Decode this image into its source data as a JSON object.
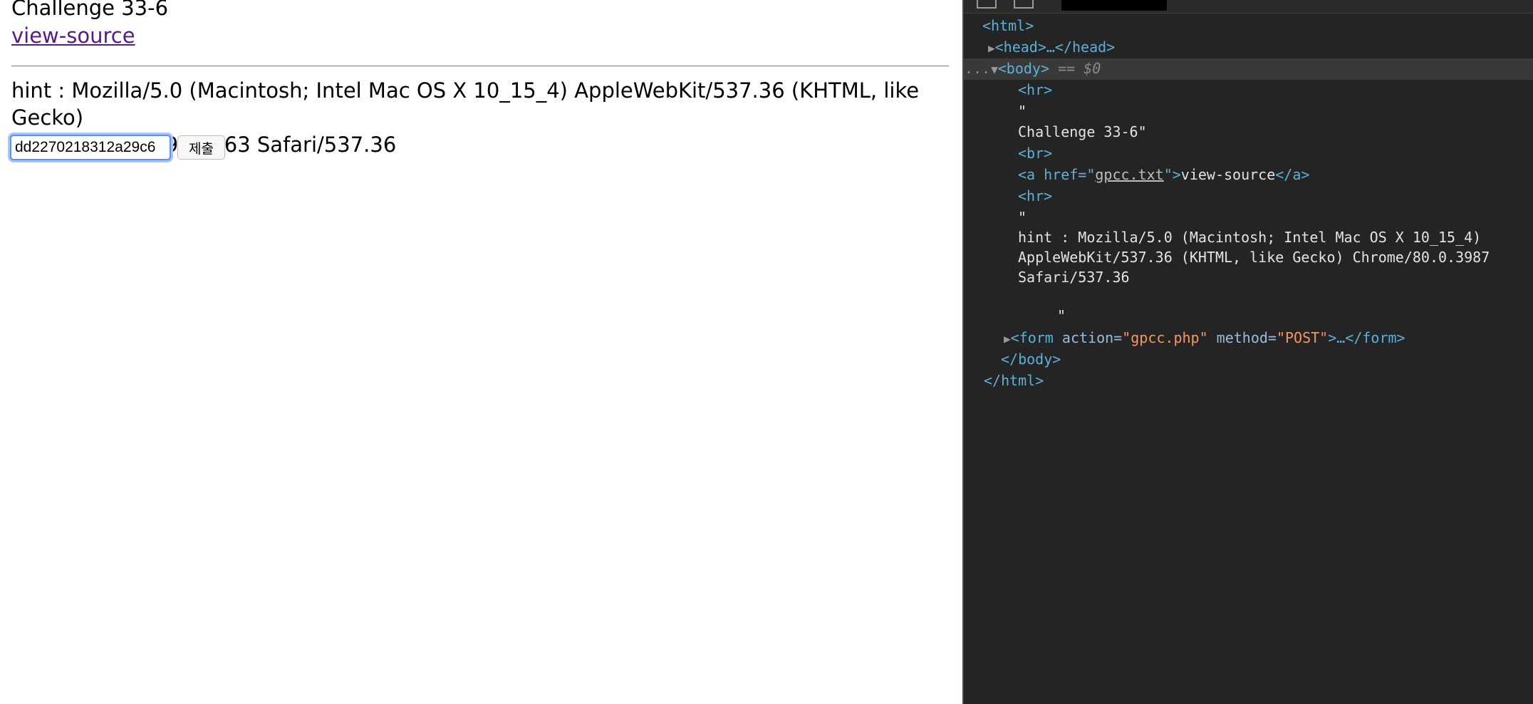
{
  "page": {
    "title": "Challenge 33-6",
    "link_text": "view-source",
    "hint_line1": "hint : Mozilla/5.0 (Macintosh; Intel Mac OS X 10_15_4) AppleWebKit/537.36 (KHTML, like Gecko)",
    "hint_line2": "Chrome/80.0.3987.163 Safari/537.36",
    "input_value": "dd2270218312a29c6",
    "submit_label": "제출"
  },
  "devtools": {
    "dom": {
      "html_open": "<html>",
      "head_collapsed": "<head>…</head>",
      "row_menu": "...",
      "body_open": "<body>",
      "body_selected_marker": "== $0",
      "hr1": "<hr>",
      "quote_open_1": "\"",
      "challenge_text": "Challenge 33-6\"",
      "br": "<br>",
      "a_open": "<a href=\"",
      "a_href": "gpcc.txt",
      "a_close_quote": "\">",
      "a_text": "view-source",
      "a_end": "</a>",
      "hr2": "<hr>",
      "quote_open_2": "\"",
      "hint_line1": "hint : Mozilla/5.0 (Macintosh; Intel Mac OS X 10_15_4)",
      "hint_line2": "AppleWebKit/537.36 (KHTML, like Gecko) Chrome/80.0.3987",
      "hint_line3": "Safari/537.36",
      "quote_close": "\"",
      "form_open": "<form",
      "form_action_attr": "action=",
      "form_action_value": "\"gpcc.php\"",
      "form_method_attr": "method=",
      "form_method_value": "\"POST\"",
      "form_rest": ">…</form>",
      "body_close": "</body>",
      "html_close": "</html>"
    },
    "toolbar_icons": [
      "inspect-icon",
      "device-toolbar-icon"
    ]
  }
}
